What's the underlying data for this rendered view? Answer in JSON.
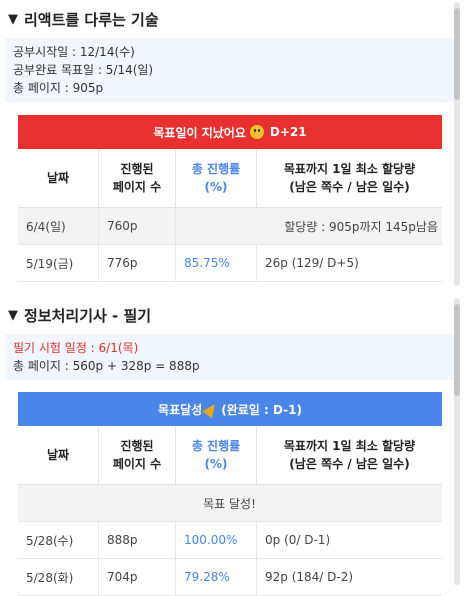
{
  "section1": {
    "title": "리액트를 다루는 기술",
    "info": [
      "공부시작일 : 12/14(수)",
      "공부완료 목표일 : 5/14(일)",
      "총 페이지 : 905p"
    ],
    "banner": {
      "text": "목표일이 지났어요",
      "dday": "D+21"
    },
    "headers": [
      "날짜",
      "진행된\n페이지 수",
      "총 진행률\n(%)",
      "목표까지 1일 최소 할당량\n(남은 쪽수 / 남은 일수)"
    ],
    "today_row": {
      "date": "6/4(일)",
      "pages": "760p",
      "note": "할당량 : 905p까지 145p남음"
    },
    "rows": [
      {
        "date": "5/19(금)",
        "pages": "776p",
        "pct": "85.75%",
        "quota": "26p (129/ D+5)"
      }
    ]
  },
  "section2": {
    "title": "정보처리기사 - 필기",
    "info_red": "필기 시험 일정 : 6/1(목)",
    "info": "총 페이지 : 560p + 328p = 888p",
    "banner": {
      "text": "목표달성",
      "suffix": "(완료일 : D-1)"
    },
    "headers": [
      "날짜",
      "진행된\n페이지 수",
      "총 진행률\n(%)",
      "목표까지 1일 최소 할당량\n(남은 쪽수 / 남은 일수)"
    ],
    "goal_row": "목표 달성!",
    "rows": [
      {
        "date": "5/28(수)",
        "pages": "888p",
        "pct": "100.00%",
        "quota": "0p (0/ D-1)"
      },
      {
        "date": "5/28(화)",
        "pages": "704p",
        "pct": "79.28%",
        "quota": "92p (184/ D-2)"
      }
    ]
  },
  "colors": {
    "red_banner": "#e8312e",
    "blue_banner": "#4a86e8",
    "info_bg": "#f1f5fc",
    "pct_text": "#4a86e8"
  }
}
